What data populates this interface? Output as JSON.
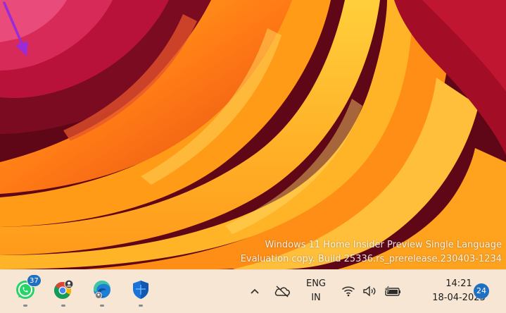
{
  "desktop": {
    "watermark_line1": "Windows 11 Home Insider Preview Single Language",
    "watermark_line2": "Evaluation copy. Build 25336.rs_prerelease.230403-1234",
    "annotation_color": "#9b2bd6"
  },
  "taskbar": {
    "background": "#f6e6d3",
    "apps": [
      {
        "name": "WhatsApp",
        "icon": "whatsapp-icon",
        "badge": "37"
      },
      {
        "name": "Google Chrome",
        "icon": "chrome-icon"
      },
      {
        "name": "Microsoft Edge",
        "icon": "edge-icon"
      },
      {
        "name": "Windows Security",
        "icon": "shield-icon"
      }
    ],
    "tray": {
      "overflow_icon": "chevron-up-icon",
      "onedrive_icon": "cloud-offline-icon",
      "language_line1": "ENG",
      "language_line2": "IN",
      "wifi_icon": "wifi-icon",
      "volume_icon": "speaker-icon",
      "battery_icon": "battery-charging-icon",
      "time": "14:21",
      "date": "18-04-2023",
      "notification_count": "24"
    }
  }
}
